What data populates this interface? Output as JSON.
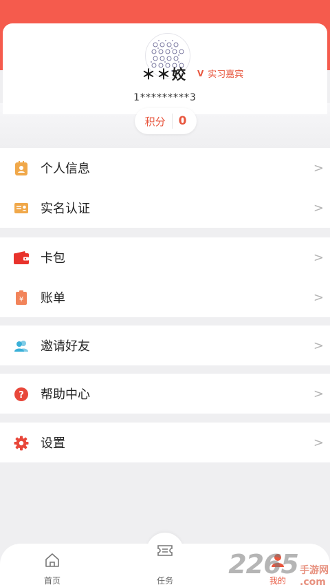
{
  "profile": {
    "name": "＊＊姣",
    "badge_letter": "V",
    "badge_text": "实习嘉宾",
    "phone": "1*********3",
    "points_label": "积分",
    "points_value": "0"
  },
  "menu_groups": [
    {
      "items": [
        {
          "label": "个人信息",
          "icon": "id-card-icon",
          "color": "#f0a84a"
        },
        {
          "label": "实名认证",
          "icon": "id-badge-icon",
          "color": "#f0a84a"
        }
      ]
    },
    {
      "items": [
        {
          "label": "卡包",
          "icon": "wallet-icon",
          "color": "#e8332c"
        },
        {
          "label": "账单",
          "icon": "bill-icon",
          "color": "#f2845a"
        }
      ]
    },
    {
      "items": [
        {
          "label": "邀请好友",
          "icon": "friends-icon",
          "color": "#3ab0d8"
        }
      ]
    },
    {
      "items": [
        {
          "label": "帮助中心",
          "icon": "help-icon",
          "color": "#e8473a"
        }
      ]
    },
    {
      "items": [
        {
          "label": "设置",
          "icon": "gear-icon",
          "color": "#e8473a"
        }
      ]
    }
  ],
  "chevron": ">",
  "tabbar": {
    "home": "首页",
    "tasks": "任务",
    "mine": "我的"
  },
  "watermark": {
    "number": "2265",
    "suffix": "手游网",
    "domain": ".com"
  },
  "colors": {
    "accent": "#e8573f",
    "header": "#f55b4d"
  }
}
